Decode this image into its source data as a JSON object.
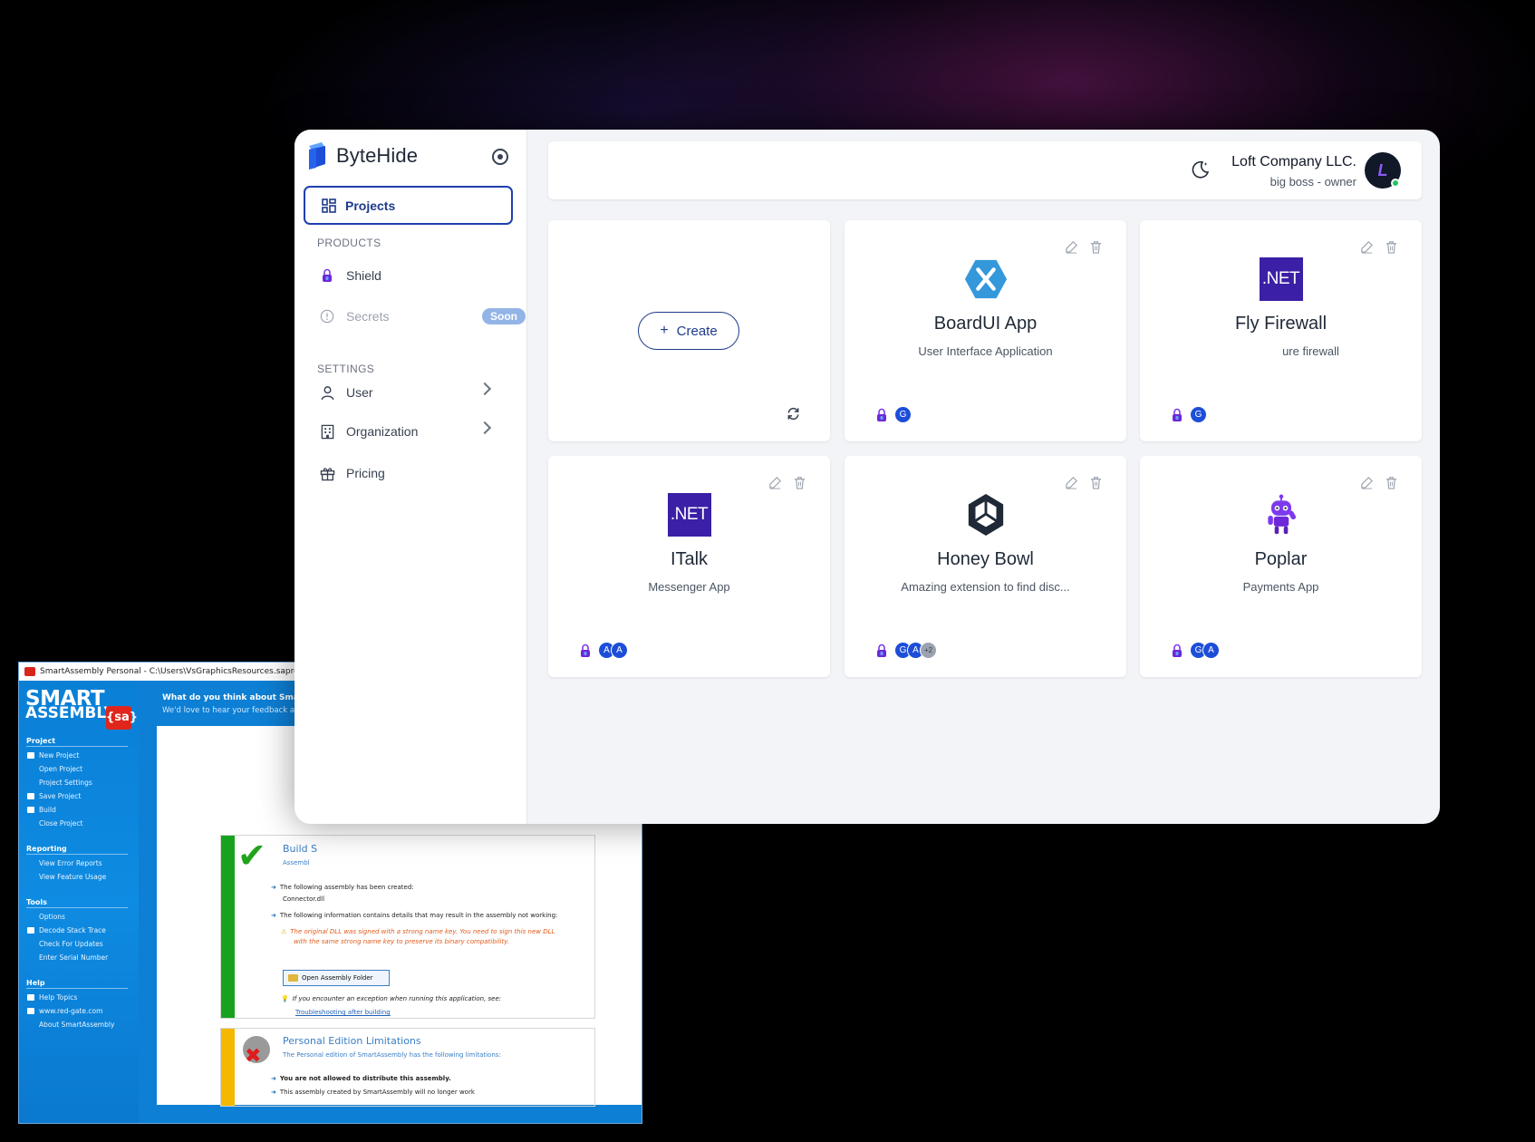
{
  "smartassembly": {
    "title": "SmartAssembly Personal - C:\\Users\\VsGraphicsResources.saproj",
    "logo_line1": "SMART",
    "logo_line2": "ASSEMBLY",
    "logo_badge": "{sa}",
    "header_title": "What do you think about SmartAsse",
    "header_sub": "We'd love to hear your feedback and",
    "sections": [
      {
        "title": "Project",
        "items": [
          "New Project",
          "Open Project",
          "Project Settings",
          "Save Project",
          "Build",
          "Close Project"
        ]
      },
      {
        "title": "Reporting",
        "items": [
          "View Error Reports",
          "View Feature Usage"
        ]
      },
      {
        "title": "Tools",
        "items": [
          "Options",
          "Decode Stack Trace",
          "Check For Updates",
          "Enter Serial Number"
        ]
      },
      {
        "title": "Help",
        "items": [
          "Help Topics",
          "www.red-gate.com",
          "About SmartAssembly"
        ]
      }
    ],
    "build_title": "Build S",
    "build_sub": "Assembl",
    "line_created": "The following assembly has been created:",
    "file_name": "Connector.dll",
    "line_info": "The following information contains details that may result in the assembly not working:",
    "warn_1": "The original DLL was signed with a strong name key. You need to sign this new DLL",
    "warn_2": "with the same strong name key to preserve its binary compatibility.",
    "open_folder_btn": "Open Assembly Folder",
    "exception_text": "If you encounter an exception when running this application, see:",
    "troubleshoot_link": "Troubleshooting after building",
    "limits_title": "Personal Edition Limitations",
    "limits_sub": "The Personal edition of SmartAssembly has the following limitations:",
    "limit_1": "You are not allowed to distribute this assembly.",
    "limit_2": "This assembly created by SmartAssembly will no longer work"
  },
  "sidebar": {
    "brand": "ByteHide",
    "projects_label": "Projects",
    "products_label": "PRODUCTS",
    "shield_label": "Shield",
    "secrets_label": "Secrets",
    "soon_badge": "Soon",
    "settings_label": "SETTINGS",
    "user_label": "User",
    "organization_label": "Organization",
    "pricing_label": "Pricing"
  },
  "topbar": {
    "company": "Loft Company LLC.",
    "role": "big boss - owner",
    "avatar_letter": "L"
  },
  "create_label": "Create",
  "cards": [
    {
      "title": "BoardUI App",
      "desc": "User Interface Application",
      "logo": "xamarin-logo",
      "chips": [
        "G"
      ]
    },
    {
      "title": "Fly Firewall",
      "desc": "ure firewall",
      "logo": "dotnet-logo",
      "logo_text": ".NET",
      "chips": [
        "G"
      ]
    },
    {
      "title": "ITalk",
      "desc": "Messenger App",
      "logo": "dotnet-logo",
      "logo_text": ".NET",
      "chips": [
        "A",
        "A"
      ]
    },
    {
      "title": "Honey Bowl",
      "desc": "Amazing extension to find disc...",
      "logo": "unity-logo",
      "chips": [
        "G",
        "A",
        "+2"
      ]
    },
    {
      "title": "Poplar",
      "desc": "Payments App",
      "logo": "robot-logo",
      "chips": [
        "G",
        "A"
      ]
    }
  ],
  "colors": {
    "accent": "#1e3a8a",
    "chip": "#1d4ed8",
    "dotnet": "#3b1fa6",
    "xamarin": "#3498db",
    "sa_blue": "#0d7fd4"
  }
}
